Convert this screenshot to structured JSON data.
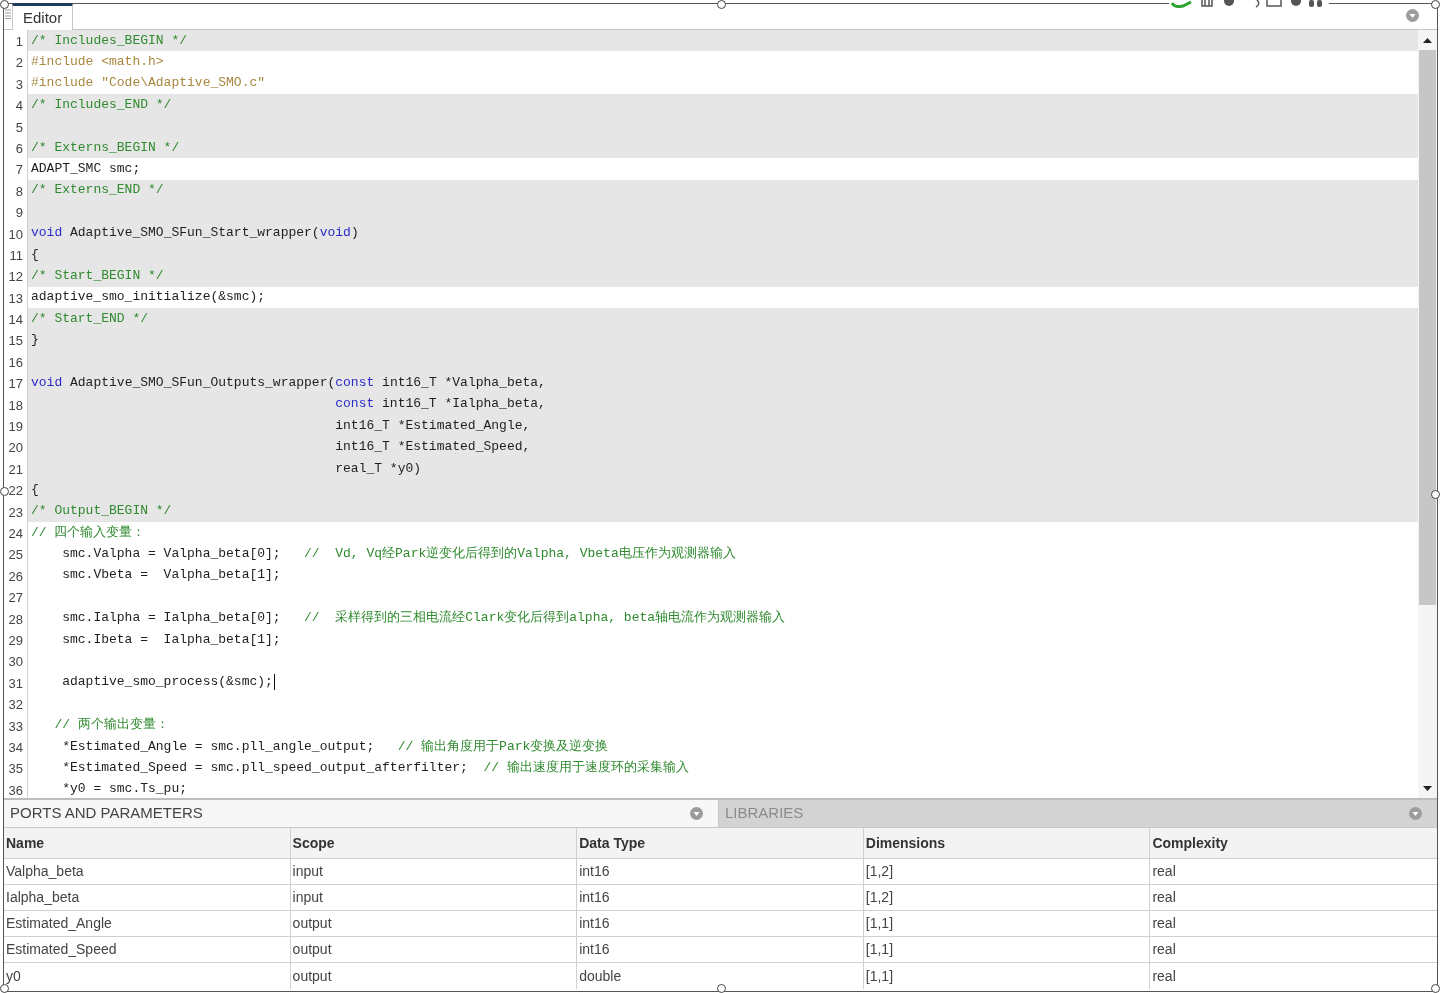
{
  "editor": {
    "tab": {
      "label": "Editor",
      "selected": true
    },
    "lines": [
      {
        "number": "1",
        "editable": false,
        "tokens": [
          {
            "kind": "comment",
            "text": "/* Includes_BEGIN */"
          }
        ]
      },
      {
        "number": "2",
        "editable": true,
        "tokens": [
          {
            "kind": "preprocessor",
            "text": "#include <math.h>"
          }
        ]
      },
      {
        "number": "3",
        "editable": true,
        "tokens": [
          {
            "kind": "preprocessor",
            "text": "#include \"Code\\Adaptive_SMO.c\""
          }
        ]
      },
      {
        "number": "4",
        "editable": false,
        "tokens": [
          {
            "kind": "comment",
            "text": "/* Includes_END */"
          }
        ]
      },
      {
        "number": "5",
        "editable": false
      },
      {
        "number": "6",
        "editable": false,
        "tokens": [
          {
            "kind": "comment",
            "text": "/* Externs_BEGIN */"
          }
        ]
      },
      {
        "number": "7",
        "editable": true,
        "tokens": [
          {
            "kind": "code",
            "text": "ADAPT_SMC smc;"
          }
        ]
      },
      {
        "number": "8",
        "editable": false,
        "tokens": [
          {
            "kind": "comment",
            "text": "/* Externs_END */"
          }
        ]
      },
      {
        "number": "9",
        "editable": false
      },
      {
        "number": "10",
        "editable": false,
        "tokens": [
          {
            "kind": "keyword",
            "text": "void"
          },
          {
            "kind": "code",
            "text": " Adaptive_SMO_SFun_Start_wrapper("
          },
          {
            "kind": "keyword",
            "text": "void"
          },
          {
            "kind": "code",
            "text": ")"
          }
        ]
      },
      {
        "number": "11",
        "editable": false,
        "tokens": [
          {
            "kind": "code",
            "text": "{"
          }
        ]
      },
      {
        "number": "12",
        "editable": false,
        "tokens": [
          {
            "kind": "comment",
            "text": "/* Start_BEGIN */"
          }
        ]
      },
      {
        "number": "13",
        "editable": true,
        "tokens": [
          {
            "kind": "code",
            "text": "adaptive_smo_initialize(&smc);"
          }
        ]
      },
      {
        "number": "14",
        "editable": false,
        "tokens": [
          {
            "kind": "comment",
            "text": "/* Start_END */"
          }
        ]
      },
      {
        "number": "15",
        "editable": false,
        "tokens": [
          {
            "kind": "code",
            "text": "}"
          }
        ]
      },
      {
        "number": "16",
        "editable": false
      },
      {
        "number": "17",
        "editable": false,
        "tokens": [
          {
            "kind": "keyword",
            "text": "void"
          },
          {
            "kind": "code",
            "text": " Adaptive_SMO_SFun_Outputs_wrapper("
          },
          {
            "kind": "keyword",
            "text": "const"
          },
          {
            "kind": "code",
            "text": " int16_T *Valpha_beta,"
          }
        ]
      },
      {
        "number": "18",
        "editable": false,
        "tokens": [
          {
            "kind": "keyword",
            "text": "                                       const"
          },
          {
            "kind": "code",
            "text": " int16_T *Ialpha_beta,"
          }
        ]
      },
      {
        "number": "19",
        "editable": false,
        "tokens": [
          {
            "kind": "code",
            "text": "                                       int16_T *Estimated_Angle,"
          }
        ]
      },
      {
        "number": "20",
        "editable": false,
        "tokens": [
          {
            "kind": "code",
            "text": "                                       int16_T *Estimated_Speed,"
          }
        ]
      },
      {
        "number": "21",
        "editable": false,
        "tokens": [
          {
            "kind": "code",
            "text": "                                       real_T *y0)"
          }
        ]
      },
      {
        "number": "22",
        "editable": false,
        "tokens": [
          {
            "kind": "code",
            "text": "{"
          }
        ]
      },
      {
        "number": "23",
        "editable": false,
        "tokens": [
          {
            "kind": "comment",
            "text": "/* Output_BEGIN */"
          }
        ]
      },
      {
        "number": "24",
        "editable": true,
        "tokens": [
          {
            "kind": "comment",
            "text": "// 四个输入变量："
          }
        ]
      },
      {
        "number": "25",
        "editable": true,
        "tokens": [
          {
            "kind": "code",
            "text": "    smc.Valpha = Valpha_beta[0];   "
          },
          {
            "kind": "comment",
            "text": "//  Vd, Vq经Park逆变化后得到的Valpha, Vbeta电压作为观测器输入"
          }
        ]
      },
      {
        "number": "26",
        "editable": true,
        "tokens": [
          {
            "kind": "code",
            "text": "    smc.Vbeta =  Valpha_beta[1];"
          }
        ]
      },
      {
        "number": "27",
        "editable": true
      },
      {
        "number": "28",
        "editable": true,
        "tokens": [
          {
            "kind": "code",
            "text": "    smc.Ialpha = Ialpha_beta[0];   "
          },
          {
            "kind": "comment",
            "text": "//  采样得到的三相电流经Clark变化后得到alpha, beta轴电流作为观测器输入"
          }
        ]
      },
      {
        "number": "29",
        "editable": true,
        "tokens": [
          {
            "kind": "code",
            "text": "    smc.Ibeta =  Ialpha_beta[1];"
          }
        ]
      },
      {
        "number": "30",
        "editable": true
      },
      {
        "number": "31",
        "editable": true,
        "cursor": true,
        "tokens": [
          {
            "kind": "code",
            "text": "    adaptive_smo_process(&smc);"
          }
        ]
      },
      {
        "number": "32",
        "editable": true
      },
      {
        "number": "33",
        "editable": true,
        "tokens": [
          {
            "kind": "comment",
            "text": "   // 两个输出变量："
          }
        ]
      },
      {
        "number": "34",
        "editable": true,
        "tokens": [
          {
            "kind": "code",
            "text": "    *Estimated_Angle = smc.pll_angle_output;   "
          },
          {
            "kind": "comment",
            "text": "// 输出角度用于Park变换及逆变换"
          }
        ]
      },
      {
        "number": "35",
        "editable": true,
        "tokens": [
          {
            "kind": "code",
            "text": "    *Estimated_Speed = smc.pll_speed_output_afterfilter;  "
          },
          {
            "kind": "comment",
            "text": "// 输出速度用于速度环的采集输入"
          }
        ]
      },
      {
        "number": "36",
        "editable": true,
        "tokens": [
          {
            "kind": "code",
            "text": "    *y0 = smc.Ts_pu;"
          }
        ]
      }
    ]
  },
  "bottom_panel": {
    "tabs": [
      {
        "label": "PORTS AND PARAMETERS",
        "selected": true
      },
      {
        "label": "LIBRARIES",
        "selected": false
      }
    ],
    "table": {
      "columns": [
        "Name",
        "Scope",
        "Data Type",
        "Dimensions",
        "Complexity"
      ],
      "rows": [
        [
          "Valpha_beta",
          "input",
          "int16",
          "[1,2]",
          "real"
        ],
        [
          "Ialpha_beta",
          "input",
          "int16",
          "[1,2]",
          "real"
        ],
        [
          "Estimated_Angle",
          "output",
          "int16",
          "[1,1]",
          "real"
        ],
        [
          "Estimated_Speed",
          "output",
          "int16",
          "[1,1]",
          "real"
        ],
        [
          "y0",
          "output",
          "double",
          "[1,1]",
          "real"
        ]
      ]
    }
  }
}
